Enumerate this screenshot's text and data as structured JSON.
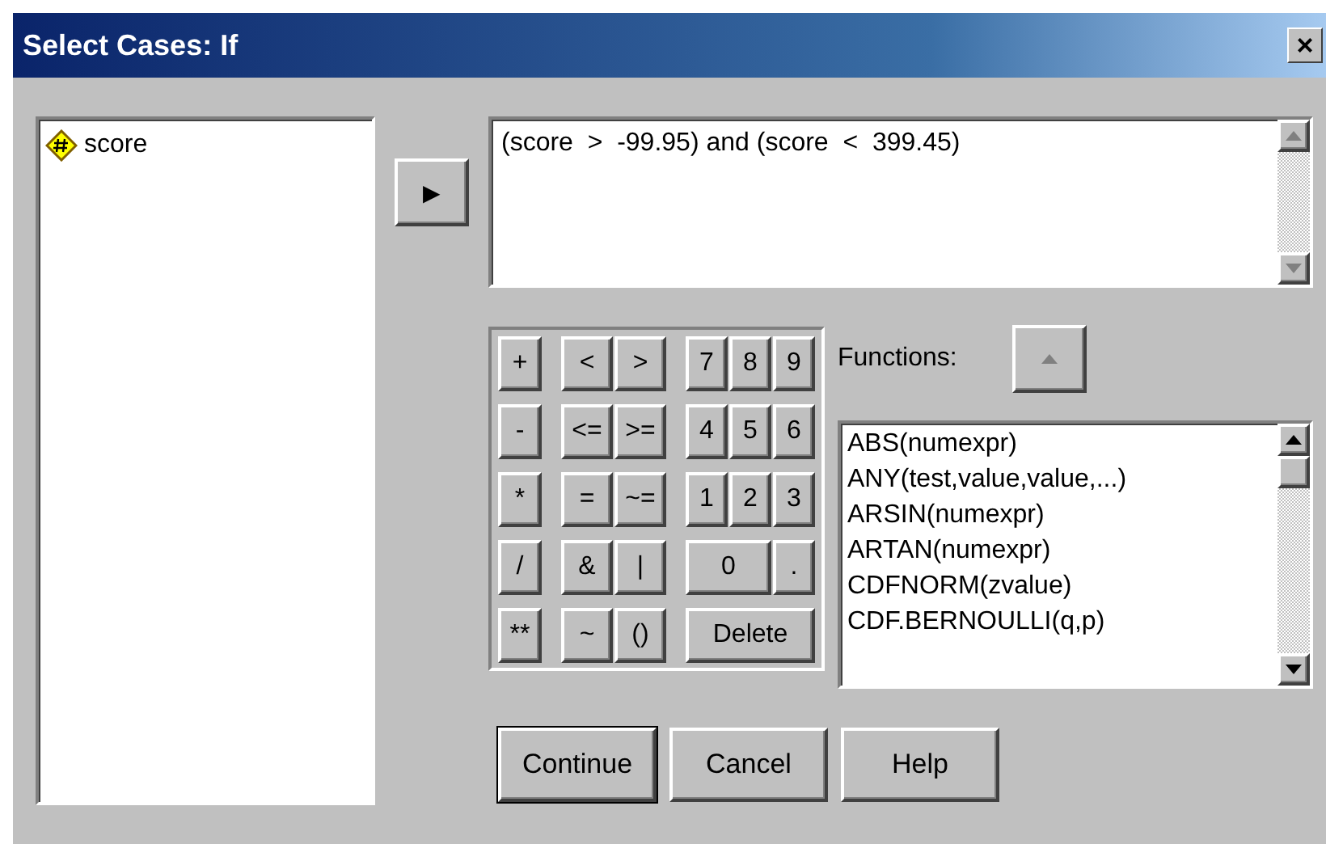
{
  "window": {
    "title": "Select Cases: If",
    "close": "×"
  },
  "variables": [
    {
      "name": "score",
      "selected": false
    }
  ],
  "move_button": {
    "label": "▶"
  },
  "expression": {
    "value": "(score  >  -99.95) and (score  <  399.45)"
  },
  "keypad": [
    {
      "label": "+",
      "kind": "single"
    },
    {
      "label": "<",
      "kind": "single"
    },
    {
      "label": ">",
      "kind": "single"
    },
    {
      "label": "7",
      "kind": "single"
    },
    {
      "label": "8",
      "kind": "single"
    },
    {
      "label": "9",
      "kind": "single"
    },
    {
      "label": "-",
      "kind": "single"
    },
    {
      "label": "<=",
      "kind": "single"
    },
    {
      "label": ">=",
      "kind": "single"
    },
    {
      "label": "4",
      "kind": "single"
    },
    {
      "label": "5",
      "kind": "single"
    },
    {
      "label": "6",
      "kind": "single"
    },
    {
      "label": "*",
      "kind": "single"
    },
    {
      "label": "=",
      "kind": "single"
    },
    {
      "label": "~=",
      "kind": "single"
    },
    {
      "label": "1",
      "kind": "single"
    },
    {
      "label": "2",
      "kind": "single"
    },
    {
      "label": "3",
      "kind": "single"
    },
    {
      "label": "/",
      "kind": "single"
    },
    {
      "label": "&",
      "kind": "single"
    },
    {
      "label": "|",
      "kind": "single"
    },
    {
      "label": "0",
      "kind": "double"
    },
    {
      "label": ".",
      "kind": "single"
    },
    {
      "label": "**",
      "kind": "single"
    },
    {
      "label": "~",
      "kind": "single"
    },
    {
      "label": "()",
      "kind": "single"
    },
    {
      "label": "Delete",
      "kind": "triple"
    }
  ],
  "functions": {
    "label": "Functions:",
    "insert_button": {
      "disabled": true
    },
    "items": [
      {
        "text": "ABS(numexpr)",
        "selected": false
      },
      {
        "text": "ANY(test,value,value,...)",
        "selected": false
      },
      {
        "text": "ARSIN(numexpr)",
        "selected": false
      },
      {
        "text": "ARTAN(numexpr)",
        "selected": false
      },
      {
        "text": "CDFNORM(zvalue)",
        "selected": false
      },
      {
        "text": "CDF.BERNOULLI(q,p)",
        "selected": false
      }
    ]
  },
  "buttons": [
    {
      "label": "Continue",
      "default": true
    },
    {
      "label": "Cancel",
      "default": false
    },
    {
      "label": "Help",
      "default": false
    }
  ]
}
